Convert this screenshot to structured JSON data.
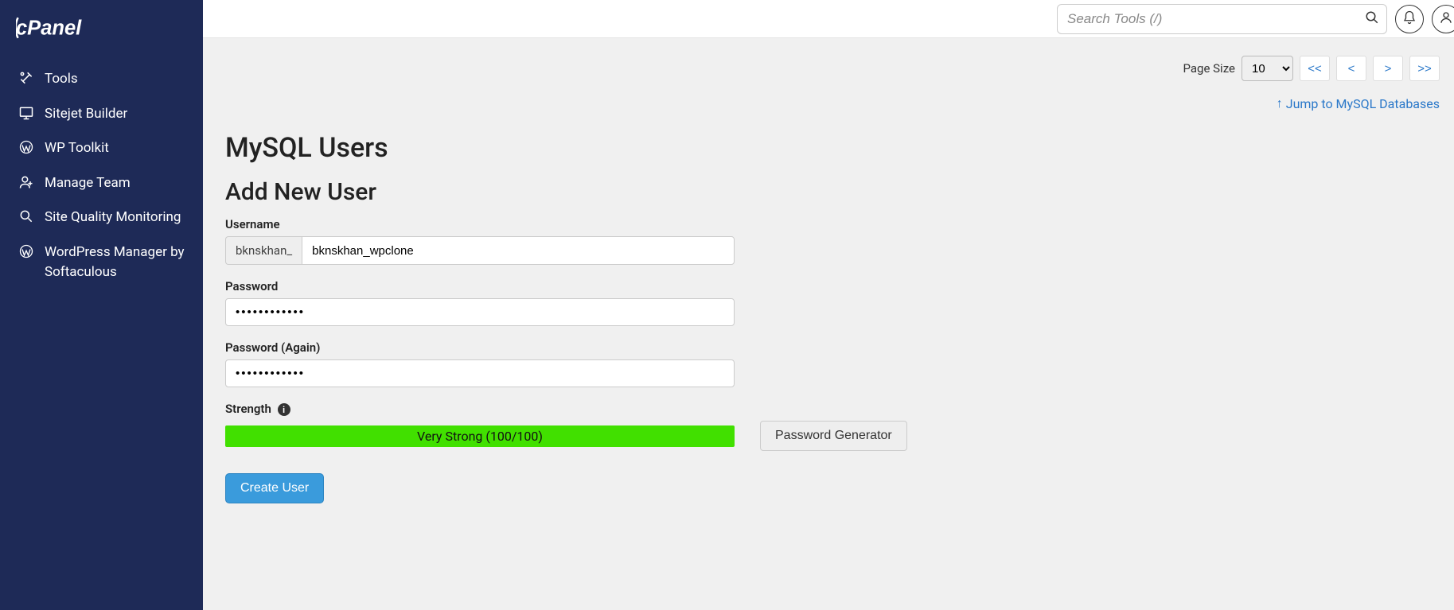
{
  "brand": "cPanel",
  "sidebar": {
    "items": [
      {
        "label": "Tools"
      },
      {
        "label": "Sitejet Builder"
      },
      {
        "label": "WP Toolkit"
      },
      {
        "label": "Manage Team"
      },
      {
        "label": "Site Quality Monitoring"
      },
      {
        "label": "WordPress Manager by Softaculous"
      }
    ]
  },
  "header": {
    "search_placeholder": "Search Tools (/)"
  },
  "pager": {
    "label": "Page Size",
    "value": "10",
    "first": "<<",
    "prev": "<",
    "next": ">",
    "last": ">>"
  },
  "jump_link": "Jump to MySQL Databases",
  "section": {
    "title": "MySQL Users",
    "subtitle": "Add New User"
  },
  "form": {
    "username_label": "Username",
    "username_prefix": "bknskhan_",
    "username_value": "bknskhan_wpclone",
    "password_label": "Password",
    "password_value": "••••••••••••",
    "password2_label": "Password (Again)",
    "password2_value": "••••••••••••",
    "strength_label": "Strength",
    "strength_text": "Very Strong (100/100)",
    "generator_btn": "Password Generator",
    "submit_btn": "Create User"
  }
}
